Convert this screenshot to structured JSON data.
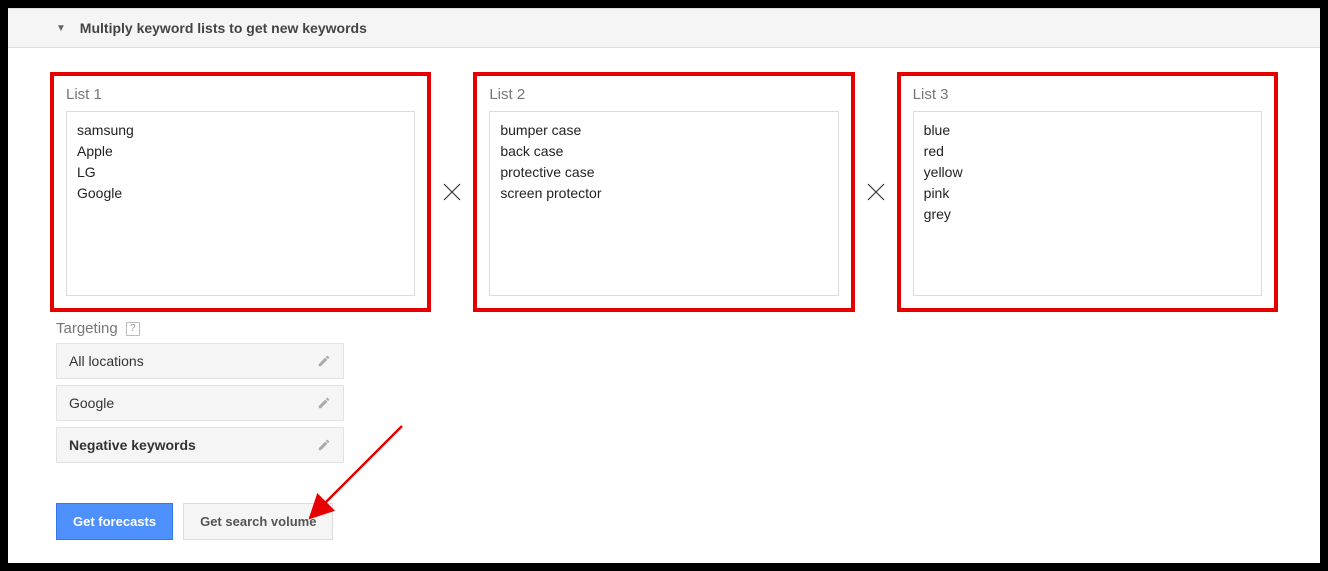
{
  "panel": {
    "title": "Multiply keyword lists to get new keywords"
  },
  "lists": {
    "list1": {
      "label": "List 1",
      "content": "samsung\nApple\nLG\nGoogle"
    },
    "list2": {
      "label": "List 2",
      "content": "bumper case\nback case\nprotective case\nscreen protector"
    },
    "list3": {
      "label": "List 3",
      "content": "blue\nred\nyellow\npink\ngrey"
    }
  },
  "targeting": {
    "title": "Targeting",
    "locations": "All locations",
    "network": "Google",
    "negative": "Negative keywords"
  },
  "buttons": {
    "forecasts": "Get forecasts",
    "volume": "Get search volume"
  }
}
